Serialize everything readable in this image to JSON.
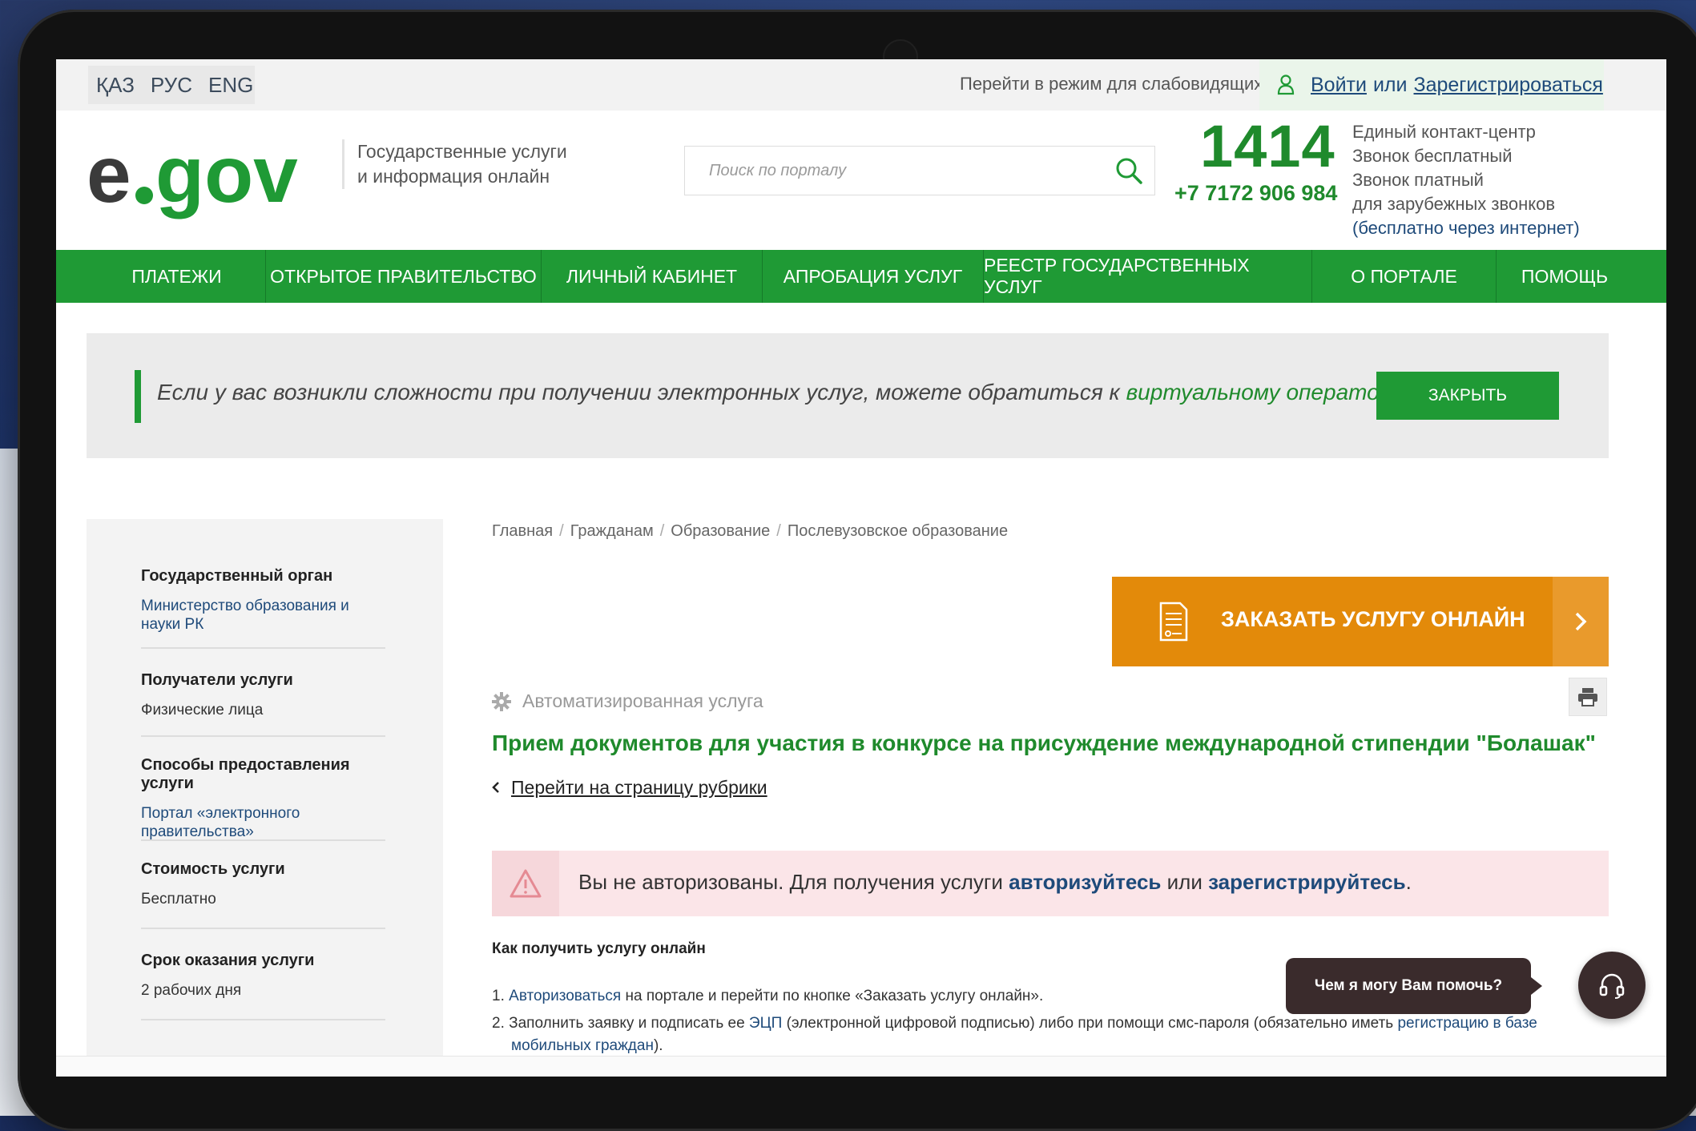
{
  "topbar": {
    "languages": [
      "ҚАЗ",
      "РУС",
      "ENG"
    ],
    "low_vision_label": "Перейти в режим для слабовидящих",
    "login_label": "Войти",
    "login_or": "или",
    "register_label": "Зарегистрироваться"
  },
  "header": {
    "logo_text": "egov",
    "tagline_line1": "Государственные услуги",
    "tagline_line2": "и информация онлайн",
    "search_placeholder": "Поиск по порталу",
    "phone_short": "1414",
    "phone_long": "+7 7172 906 984",
    "phone_info_1": "Единый контакт-центр",
    "phone_info_2": "Звонок бесплатный",
    "phone_info_3": "Звонок платный",
    "phone_info_4": "для зарубежных звонков",
    "phone_info_5": "(бесплатно через интернет)"
  },
  "nav": {
    "items": [
      "ПЛАТЕЖИ",
      "ОТКРЫТОЕ ПРАВИТЕЛЬСТВО",
      "ЛИЧНЫЙ КАБИНЕТ",
      "АПРОБАЦИЯ УСЛУГ",
      "РЕЕСТР ГОСУДАРСТВЕННЫХ УСЛУГ",
      "О ПОРТАЛЕ",
      "ПОМОЩЬ"
    ]
  },
  "banner": {
    "text": "Если у вас возникли сложности при получении электронных услуг, можете обратиться к ",
    "link": "виртуальному оператору",
    "close_label": "ЗАКРЫТЬ"
  },
  "sidebar": {
    "groups": [
      {
        "title": "Государственный орган",
        "value": "Министерство образования и науки РК"
      },
      {
        "title": "Получатели услуги",
        "value": "Физические лица"
      },
      {
        "title": "Способы предоставления услуги",
        "value": "Портал «электронного правительства»"
      },
      {
        "title": "Стоимость услуги",
        "value": "Бесплатно"
      },
      {
        "title": "Срок оказания услуги",
        "value": "2 рабочих дня"
      }
    ]
  },
  "breadcrumb": [
    "Главная",
    "Гражданам",
    "Образование",
    "Послевузовское образование"
  ],
  "order_button_label": "ЗАКАЗАТЬ УСЛУГУ ОНЛАЙН",
  "service": {
    "type_label": "Автоматизированная услуга",
    "title": "Прием документов для участия в конкурсе на присуждение международной стипендии \"Болашак\"",
    "back_link": "Перейти на страницу рубрики"
  },
  "alert": {
    "text_1": "Вы не авторизованы. Для получения услуги ",
    "link_1": "авторизуйтесь",
    "text_2": " или ",
    "link_2": "зарегистрируйтесь",
    "text_3": "."
  },
  "how_to": {
    "title": "Как получить услугу онлайн",
    "step1_num": "1.",
    "step1_link": "Авторизоваться",
    "step1_text": " на портале и перейти по кнопке «Заказать услугу онлайн».",
    "step2_num": "2.",
    "step2_text_a": "Заполнить заявку и подписать ее ",
    "step2_link_a": "ЭЦП",
    "step2_text_b": " (электронной цифровой подписью) либо при помощи смс-пароля (обязательно иметь ",
    "step2_link_b": "регистрацию в базе мобильных граждан",
    "step2_text_c": ")."
  },
  "chat": {
    "bubble_text": "Чем я могу Вам помочь?"
  },
  "colors": {
    "brand_green": "#1f9a35",
    "order_orange": "#e38a0a",
    "link_blue": "#1e4a7a"
  }
}
